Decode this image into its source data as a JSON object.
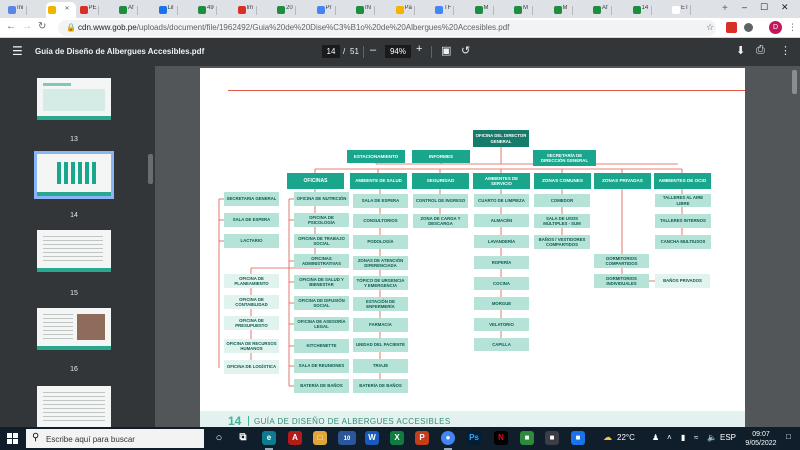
{
  "browser": {
    "tabs": [
      {
        "title": "Ini",
        "color": "#5b86e5",
        "active": false
      },
      {
        "title": "",
        "color": "#f2b400",
        "active": true
      },
      {
        "title": "PE",
        "color": "#d93025",
        "active": false
      },
      {
        "title": "Af",
        "color": "#1e8e3e",
        "active": false
      },
      {
        "title": "Lil",
        "color": "#1a73e8",
        "active": false
      },
      {
        "title": "49",
        "color": "#1e8e3e",
        "active": false
      },
      {
        "title": "Im",
        "color": "#d93025",
        "active": false
      },
      {
        "title": "20",
        "color": "#1e8e3e",
        "active": false
      },
      {
        "title": "Pr",
        "color": "#4285f4",
        "active": false
      },
      {
        "title": "IN",
        "color": "#1e8e3e",
        "active": false
      },
      {
        "title": "Pa",
        "color": "#f2b400",
        "active": false
      },
      {
        "title": "TF",
        "color": "#4285f4",
        "active": false
      },
      {
        "title": "M",
        "color": "#1e8e3e",
        "active": false
      },
      {
        "title": "M",
        "color": "#1e8e3e",
        "active": false
      },
      {
        "title": "M",
        "color": "#1e8e3e",
        "active": false
      },
      {
        "title": "Af",
        "color": "#1e8e3e",
        "active": false
      },
      {
        "title": "14",
        "color": "#1e8e3e",
        "active": false
      },
      {
        "title": "ET Pa",
        "color": "#ffffff",
        "active": false
      }
    ],
    "new_tab": "+",
    "url_domain": "cdn.www.gob.pe",
    "url_path": "/uploads/document/file/1962492/Guia%20de%20Dise%C3%B1o%20de%20Albergues%20Accesibles.pdf",
    "profile_initial": "D",
    "win_min": "–",
    "win_max": "☐",
    "win_close": "✕"
  },
  "pdf": {
    "doc_title": "Guía de Diseño de Albergues Accesibles.pdf",
    "current_page": "14",
    "page_sep": "/",
    "total_pages": "51",
    "zoom": "94%",
    "zoom_out": "–",
    "zoom_in": "+"
  },
  "sidebar": {
    "pages": [
      "13",
      "14",
      "15",
      "16"
    ],
    "selected": "14"
  },
  "page_content": {
    "footer_number": "14",
    "footer_title": "GUÍA DE DISEÑO DE ALBERGUES ACCESIBLES",
    "org": {
      "top": "OFICINA DEL DIRECTOR GENERAL",
      "estacionamiento": "ESTACIONAMIENTO",
      "informes": "INFORMES",
      "secretaria_direccion": "SECRETARÍA DE DIRECCIÓN GENERAL",
      "heads": [
        "OFICINAS",
        "AMBIENTE DE SALUD",
        "SEGURIDAD",
        "AMBIENTES DE SERVICIO",
        "ZONAS COMUNES",
        "ZONAS PRIVADAS",
        "AMBIENTES DE OCIO"
      ],
      "col1_left": [
        "SECRETARIA GENERAL",
        "SALA DE ESPERA",
        "LACTARIO"
      ],
      "col1_right": [
        "OFICINA DE NUTRICIÓN",
        "OFICINA DE PSICOLOGÍA",
        "OFICINA DE TRABAJO SOCIAL",
        "OFICINAS ADMINISTRATIVAS"
      ],
      "col1_sub_left": [
        "OFICINA DE PLANEAMIENTO",
        "OFICINA DE CONTABILIDAD",
        "OFICINA DE PRESUPUESTO",
        "OFICINA DE RECURSOS HUMANOS",
        "OFICINA DE LOGÍSTICA"
      ],
      "col1_sub_right": [
        "OFICINA DE SALUD Y BIENESTAR",
        "OFICINA DE DIFUSIÓN SOCIAL",
        "OFICINA DE ASESORÍA LEGAL",
        "KITCHENETTE",
        "SALA DE REUNIONES",
        "BATERÍA DE BAÑOS"
      ],
      "salud": [
        "SALA DE ESPERA",
        "CONSULTORIOS",
        "PODOLOGÍA",
        "ZONAS DE ATENCIÓN DIFERENCIADA",
        "TÓPICO DE URGENCIA Y EMERGENCIA",
        "ESTACIÓN DE ENFERMERÍA",
        "FARMACIA",
        "UNIDAD DEL PACIENTE",
        "TRIAJE",
        "BATERÍA DE BAÑOS"
      ],
      "seguridad": [
        "CONTROL DE INGRESO",
        "ZONA DE CARGA Y DESCARGA"
      ],
      "servicio": [
        "CUARTO DE LIMPIEZA",
        "ALMACÉN",
        "LAVANDERÍA",
        "ROPERÍA",
        "COCINA",
        "MORGUE",
        "VELATORIO",
        "CAPILLA"
      ],
      "comunes": [
        "COMEDOR",
        "SALA DE USOS MÚLTIPLES - SUM",
        "BAÑOS / VESTIDORES COMPARTIDOS"
      ],
      "privadas": [
        "DORMITORIOS COMPARTIDOS",
        "DORMITORIOS INDIVIDUALES",
        "BAÑOS PRIVADOS"
      ],
      "ocio": [
        "TALLERES AL AIRE LIBRE",
        "TALLERES INTERNOS",
        "CANCHA MULTIUSOS"
      ]
    }
  },
  "taskbar": {
    "search_placeholder": "Escribe aquí para buscar",
    "badge": "10",
    "weather": "22°C",
    "lang": "ESP",
    "time": "09:07",
    "date": "9/05/2022"
  }
}
